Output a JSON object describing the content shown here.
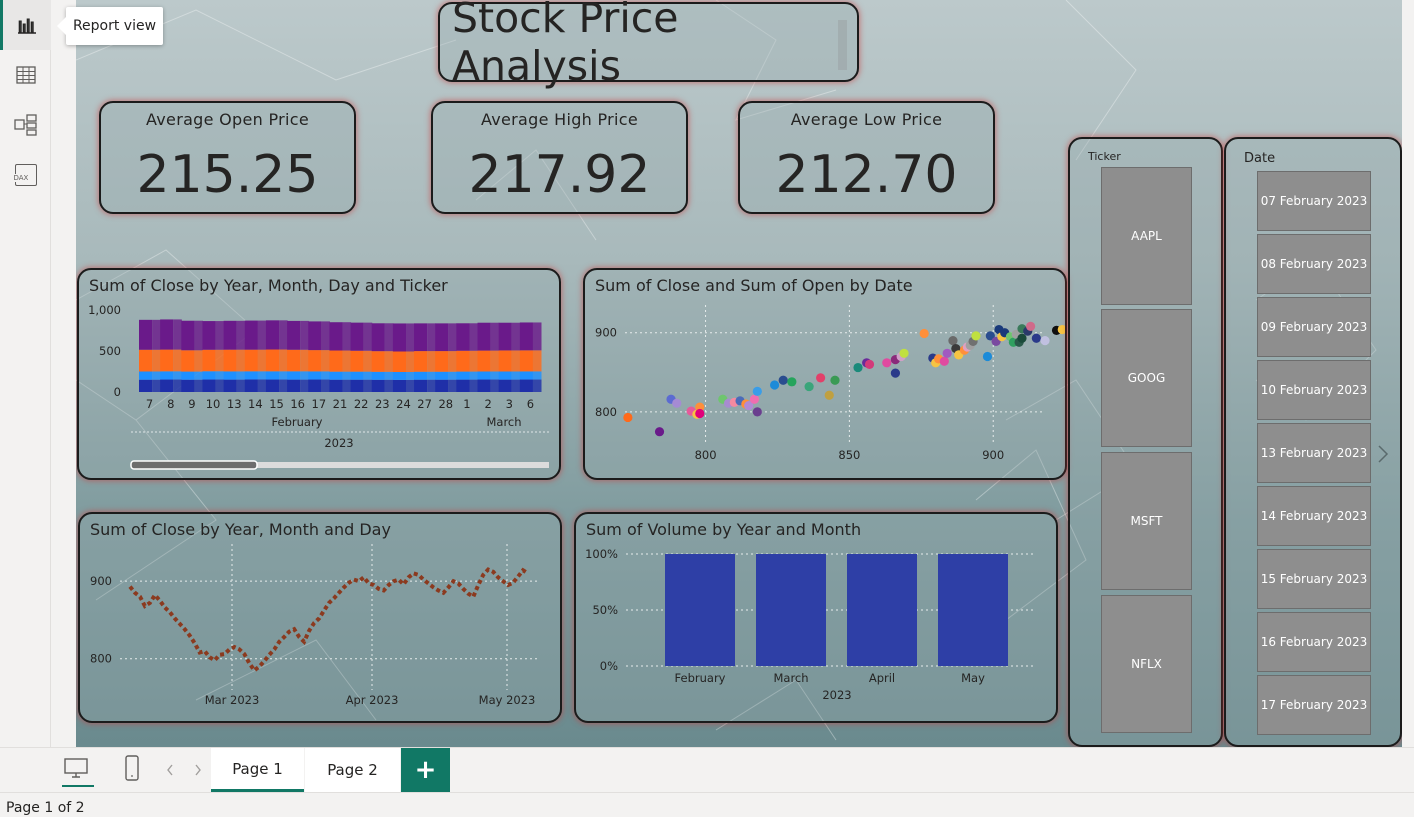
{
  "rail": {
    "items": [
      {
        "name": "report-view-icon",
        "active": true
      },
      {
        "name": "table-view-icon",
        "active": false
      },
      {
        "name": "model-view-icon",
        "active": false
      },
      {
        "name": "dax-query-view-icon",
        "active": false
      }
    ],
    "tooltip": "Report view",
    "dax_label": "DAX"
  },
  "report": {
    "title": "Stock Price Analysis",
    "kpis": [
      {
        "label": "Average Open Price",
        "value": "215.25"
      },
      {
        "label": "Average High Price",
        "value": "217.92"
      },
      {
        "label": "Average Low Price",
        "value": "212.70"
      }
    ],
    "visuals": {
      "ticker_chart_title": "Sum of Close by Year, Month, Day and Ticker",
      "scatter_title": "Sum of Close and Sum of Open by Date",
      "line_title": "Sum of Close by Year, Month and Day",
      "volume_title": "Sum of Volume by Year and Month"
    },
    "ticker_slicer": {
      "title": "Ticker",
      "items": [
        "AAPL",
        "GOOG",
        "MSFT",
        "NFLX"
      ]
    },
    "date_slicer": {
      "title": "Date",
      "items": [
        "07 February 2023",
        "08 February 2023",
        "09 February 2023",
        "10 February 2023",
        "13 February 2023",
        "14 February 2023",
        "15 February 2023",
        "16 February 2023",
        "17 February 2023"
      ],
      "next_icon": "chevron-right-icon"
    }
  },
  "chart_data": [
    {
      "type": "bar",
      "stacked": true,
      "title": "Sum of Close by Year, Month, Day and Ticker",
      "ylim": [
        0,
        1000
      ],
      "y_ticks": [
        "1,000",
        "500",
        "0"
      ],
      "x_tick_labels": [
        "7",
        "8",
        "9",
        "10",
        "13",
        "14",
        "15",
        "16",
        "17",
        "21",
        "22",
        "23",
        "24",
        "27",
        "28",
        "1",
        "2",
        "3",
        "6"
      ],
      "month_labels": [
        "February",
        "March"
      ],
      "year_label": "2023",
      "series": [
        {
          "color": "#1f2fa8",
          "values": [
            150,
            152,
            150,
            152,
            151,
            153,
            152,
            151,
            152,
            150,
            150,
            149,
            148,
            150,
            150,
            151,
            152,
            151,
            152
          ]
        },
        {
          "color": "#1e90ff",
          "values": [
            100,
            100,
            99,
            101,
            100,
            99,
            100,
            101,
            99,
            98,
            98,
            97,
            96,
            97,
            97,
            98,
            98,
            99,
            99
          ]
        },
        {
          "color": "#ff6a1a",
          "values": [
            265,
            265,
            260,
            262,
            265,
            264,
            266,
            263,
            260,
            258,
            255,
            252,
            250,
            252,
            252,
            254,
            255,
            257,
            257
          ]
        },
        {
          "color": "#6a1a8a",
          "values": [
            365,
            368,
            360,
            350,
            352,
            355,
            356,
            352,
            350,
            345,
            343,
            340,
            342,
            338,
            338,
            335,
            340,
            338,
            340
          ]
        }
      ]
    },
    {
      "type": "scatter",
      "title": "Sum of Close and Sum of Open by Date",
      "xlim": [
        772,
        918
      ],
      "ylim": [
        762,
        935
      ],
      "x_ticks": [
        800,
        850,
        900
      ],
      "y_ticks": [
        800,
        900
      ],
      "points": [
        [
          773,
          793,
          "#ff6a1a"
        ],
        [
          784,
          775,
          "#6a1a8a"
        ],
        [
          788,
          816,
          "#5b6bd1"
        ],
        [
          790,
          811,
          "#a58bd3"
        ],
        [
          795,
          801,
          "#e65a9a"
        ],
        [
          797,
          797,
          "#f6c443"
        ],
        [
          798,
          806,
          "#ff8f3a"
        ],
        [
          798,
          798,
          "#e0007a"
        ],
        [
          806,
          816,
          "#6ec56e"
        ],
        [
          808,
          811,
          "#a78bd0"
        ],
        [
          810,
          812,
          "#f48aa0"
        ],
        [
          812,
          814,
          "#4b6bb8"
        ],
        [
          814,
          810,
          "#ff8f3a"
        ],
        [
          815,
          808,
          "#b28ad6"
        ],
        [
          817,
          816,
          "#f06eb0"
        ],
        [
          818,
          800,
          "#6a3e8e"
        ],
        [
          818,
          826,
          "#3a9de8"
        ],
        [
          824,
          834,
          "#1c8bd8"
        ],
        [
          827,
          840,
          "#2a4d8f"
        ],
        [
          830,
          838,
          "#25a45c"
        ],
        [
          836,
          832,
          "#3aa57a"
        ],
        [
          840,
          843,
          "#e2406a"
        ],
        [
          843,
          821,
          "#c0a040"
        ],
        [
          845,
          840,
          "#3a9a54"
        ],
        [
          853,
          856,
          "#1a8a7a"
        ],
        [
          856,
          862,
          "#6a2a9a"
        ],
        [
          857,
          860,
          "#d33a7a"
        ],
        [
          863,
          862,
          "#e04aa0"
        ],
        [
          866,
          849,
          "#2a3a8a"
        ],
        [
          866,
          866,
          "#8a2a7a"
        ],
        [
          868,
          870,
          "#d0a0c8"
        ],
        [
          869,
          874,
          "#c0e040"
        ],
        [
          876,
          899,
          "#ff8f3a"
        ],
        [
          879,
          868,
          "#2a3a8a"
        ],
        [
          880,
          862,
          "#f6c443"
        ],
        [
          881,
          867,
          "#ff8f3a"
        ],
        [
          883,
          864,
          "#e04aa0"
        ],
        [
          884,
          874,
          "#a05ac0"
        ],
        [
          886,
          890,
          "#6a6a6a"
        ],
        [
          887,
          880,
          "#3a3a3a"
        ],
        [
          888,
          872,
          "#f6c443"
        ],
        [
          890,
          878,
          "#ff8f3a"
        ],
        [
          891,
          882,
          "#e0a0c0"
        ],
        [
          892,
          884,
          "#a0a0a0"
        ],
        [
          893,
          889,
          "#707070"
        ],
        [
          894,
          896,
          "#c0e040"
        ],
        [
          898,
          870,
          "#1c8bd8"
        ],
        [
          899,
          896,
          "#2a4d8f"
        ],
        [
          901,
          889,
          "#7a4aa0"
        ],
        [
          902,
          904,
          "#1a3a7a"
        ],
        [
          903,
          895,
          "#f6c443"
        ],
        [
          904,
          900,
          "#1a3a7a"
        ],
        [
          906,
          895,
          "#6ec56e"
        ],
        [
          907,
          888,
          "#30a060"
        ],
        [
          908,
          898,
          "#a0a0a0"
        ],
        [
          909,
          888,
          "#2a5a4a"
        ],
        [
          910,
          905,
          "#3a7a5a"
        ],
        [
          910,
          893,
          "#1a4a3a"
        ],
        [
          912,
          902,
          "#2a3a6a"
        ],
        [
          913,
          908,
          "#d06a8a"
        ],
        [
          915,
          893,
          "#2a3a8a"
        ],
        [
          918,
          890,
          "#c0c0e0"
        ],
        [
          922,
          903,
          "#101010"
        ],
        [
          924,
          904,
          "#f6c443"
        ]
      ]
    },
    {
      "type": "line",
      "title": "Sum of Close by Year, Month and Day",
      "ylim": [
        770,
        935
      ],
      "y_ticks": [
        800,
        900
      ],
      "x_ticks": [
        "Mar 2023",
        "Apr 2023",
        "May 2023"
      ],
      "color": "#8b3a1f",
      "values": [
        893,
        885,
        880,
        868,
        872,
        882,
        875,
        866,
        860,
        852,
        845,
        838,
        830,
        820,
        808,
        810,
        802,
        798,
        805,
        806,
        812,
        815,
        812,
        806,
        794,
        785,
        790,
        797,
        805,
        812,
        822,
        828,
        835,
        838,
        828,
        822,
        836,
        846,
        852,
        862,
        872,
        878,
        885,
        892,
        898,
        902,
        900,
        905,
        897,
        895,
        890,
        888,
        895,
        900,
        902,
        896,
        905,
        910,
        908,
        902,
        897,
        892,
        888,
        885,
        892,
        900,
        897,
        890,
        884,
        880,
        895,
        908,
        915,
        912,
        905,
        900,
        895,
        898,
        906,
        914,
        910
      ]
    },
    {
      "type": "bar",
      "title": "Sum of Volume by Year and Month",
      "categories": [
        "February",
        "March",
        "April",
        "May"
      ],
      "values": [
        100,
        100,
        100,
        100
      ],
      "y_ticks": [
        "100%",
        "50%",
        "0%"
      ],
      "year_label": "2023",
      "color": "#2e3fa6"
    }
  ],
  "tabs": {
    "pages": [
      "Page 1",
      "Page 2"
    ],
    "active": 0,
    "add_label": "+"
  },
  "status": {
    "page_info": "Page 1 of 2"
  }
}
